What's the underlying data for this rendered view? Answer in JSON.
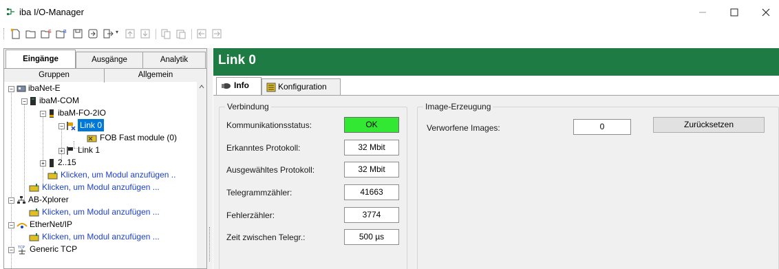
{
  "window": {
    "title": "iba I/O-Manager"
  },
  "toolbar": {
    "icons": [
      "new-icon",
      "open-icon",
      "open-special-icon",
      "open-config-icon",
      "save-icon",
      "import-icon",
      "export-icon",
      "move-up-icon",
      "move-down-icon",
      "copy-icon",
      "paste-icon",
      "back-icon",
      "forward-icon"
    ]
  },
  "left": {
    "tabs": [
      "Eingänge",
      "Ausgänge",
      "Analytik"
    ],
    "subtabs": [
      "Gruppen",
      "Allgemein"
    ],
    "tree": [
      {
        "label": "ibaNet-E"
      },
      {
        "label": "ibaM-COM"
      },
      {
        "label": "ibaM-FO-2IO"
      },
      {
        "label": "Link 0"
      },
      {
        "label": "FOB Fast module (0)"
      },
      {
        "label": "Link 1"
      },
      {
        "label": "2..15"
      },
      {
        "label": "Klicken, um Modul anzufügen .."
      },
      {
        "label": "Klicken, um Modul anzufügen ..."
      },
      {
        "label": "AB-Xplorer"
      },
      {
        "label": "Klicken, um Modul anzufügen ..."
      },
      {
        "label": "EtherNet/IP"
      },
      {
        "label": "Klicken, um Modul anzufügen ..."
      },
      {
        "label": "Generic TCP"
      }
    ]
  },
  "right": {
    "title": "Link 0",
    "tabs": [
      "Info",
      "Konfiguration"
    ],
    "verbindung": {
      "title": "Verbindung",
      "rows": [
        {
          "label": "Kommunikationsstatus:",
          "value": "OK"
        },
        {
          "label": "Erkanntes Protokoll:",
          "value": "32 Mbit"
        },
        {
          "label": "Ausgewähltes Protokoll:",
          "value": "32 Mbit"
        },
        {
          "label": "Telegrammzähler:",
          "value": "41663"
        },
        {
          "label": "Fehlerzähler:",
          "value": "3774"
        },
        {
          "label": "Zeit zwischen Telegr.:",
          "value": "500 µs"
        }
      ]
    },
    "image": {
      "title": "Image-Erzeugung",
      "label": "Verworfene Images:",
      "value": "0",
      "button": "Zurücksetzen"
    }
  },
  "colors": {
    "header": "#1e7b44",
    "ok": "#33e833",
    "selection": "#0078d7",
    "link": "#1d3fc7"
  }
}
